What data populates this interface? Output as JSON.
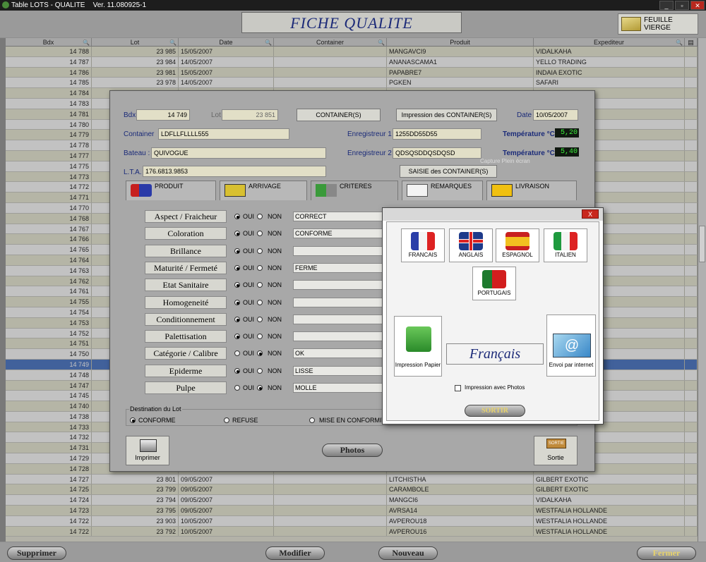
{
  "window": {
    "title": "Table LOTS - QUALITE",
    "version": "Ver. 11.080925-1"
  },
  "header": {
    "title": "FICHE QUALITE",
    "feuille_vierge": "FEUILLE VIERGE"
  },
  "grid": {
    "columns": [
      "Bdx",
      "Lot",
      "Date",
      "Container",
      "Produit",
      "Expediteur"
    ],
    "rows": [
      [
        "14 788",
        "23 985",
        "15/05/2007",
        "",
        "MANGAVCI9",
        "VIDALKAHA"
      ],
      [
        "14 787",
        "23 984",
        "14/05/2007",
        "",
        "ANANASCAMA1",
        "YELLO TRADING"
      ],
      [
        "14 786",
        "23 981",
        "15/05/2007",
        "",
        "PAPABRE7",
        "INDAIA EXOTIC"
      ],
      [
        "14 785",
        "23 978",
        "14/05/2007",
        "",
        "PGKEN",
        "SAFARI"
      ],
      [
        "14 784",
        "",
        "",
        "",
        "",
        ""
      ],
      [
        "14 783",
        "",
        "",
        "",
        "",
        ""
      ],
      [
        "14 781",
        "",
        "",
        "",
        "",
        ""
      ],
      [
        "14 780",
        "",
        "",
        "",
        "",
        ""
      ],
      [
        "14 779",
        "",
        "",
        "",
        "",
        ""
      ],
      [
        "14 778",
        "",
        "",
        "",
        "",
        ""
      ],
      [
        "14 777",
        "",
        "",
        "",
        "",
        ""
      ],
      [
        "14 775",
        "",
        "",
        "",
        "",
        ""
      ],
      [
        "14 773",
        "",
        "",
        "",
        "",
        ""
      ],
      [
        "14 772",
        "",
        "",
        "",
        "",
        "UNION"
      ],
      [
        "14 771",
        "",
        "",
        "",
        "",
        ""
      ],
      [
        "14 770",
        "",
        "",
        "",
        "",
        ""
      ],
      [
        "14 768",
        "",
        "",
        "",
        "",
        ""
      ],
      [
        "14 767",
        "",
        "",
        "",
        "",
        ""
      ],
      [
        "14 766",
        "",
        "",
        "",
        "",
        ""
      ],
      [
        "14 765",
        "",
        "",
        "",
        "",
        ""
      ],
      [
        "14 764",
        "",
        "",
        "",
        "",
        ""
      ],
      [
        "14 763",
        "",
        "",
        "",
        "",
        ""
      ],
      [
        "14 762",
        "",
        "",
        "",
        "",
        ""
      ],
      [
        "14 761",
        "",
        "",
        "",
        "",
        ""
      ],
      [
        "14 755",
        "",
        "",
        "",
        "",
        ""
      ],
      [
        "14 754",
        "",
        "",
        "",
        "",
        ""
      ],
      [
        "14 753",
        "",
        "",
        "",
        "",
        ""
      ],
      [
        "14 752",
        "",
        "",
        "",
        "",
        ""
      ],
      [
        "14 751",
        "",
        "",
        "",
        "",
        ""
      ],
      [
        "14 750",
        "",
        "",
        "",
        "",
        ""
      ],
      [
        "14 749",
        "",
        "",
        "",
        "",
        ""
      ],
      [
        "14 748",
        "",
        "",
        "",
        "",
        ""
      ],
      [
        "14 747",
        "",
        "",
        "",
        "",
        ""
      ],
      [
        "14 745",
        "",
        "",
        "",
        "",
        ""
      ],
      [
        "14 740",
        "",
        "",
        "",
        "",
        ""
      ],
      [
        "14 738",
        "",
        "",
        "",
        "",
        ""
      ],
      [
        "14 733",
        "",
        "",
        "",
        "",
        ""
      ],
      [
        "14 732",
        "",
        "",
        "",
        "",
        ""
      ],
      [
        "14 731",
        "",
        "",
        "",
        "",
        ""
      ],
      [
        "14 729",
        "",
        "",
        "",
        "",
        "NDE"
      ],
      [
        "14 728",
        "",
        "",
        "",
        "",
        ""
      ],
      [
        "14 727",
        "23 801",
        "09/05/2007",
        "",
        "LITCHISTHA",
        "GILBERT EXOTIC"
      ],
      [
        "14 725",
        "23 799",
        "09/05/2007",
        "",
        "CARAMBOLE",
        "GILBERT EXOTIC"
      ],
      [
        "14 724",
        "23 794",
        "09/05/2007",
        "",
        "MANGCI6",
        "VIDALKAHA"
      ],
      [
        "14 723",
        "23 795",
        "09/05/2007",
        "",
        "AVRSA14",
        "WESTFALIA HOLLANDE"
      ],
      [
        "14 722",
        "23 903",
        "10/05/2007",
        "",
        "AVPEROU18",
        "WESTFALIA HOLLANDE"
      ],
      [
        "14 722",
        "23 792",
        "10/05/2007",
        "",
        "AVPEROU16",
        "WESTFALIA HOLLANDE"
      ]
    ]
  },
  "footer": {
    "supprimer": "Supprimer",
    "modifier": "Modifier",
    "nouveau": "Nouveau",
    "fermer": "Fermer"
  },
  "dialog": {
    "bdx_label": "Bdx",
    "bdx": "14 749",
    "lot_label": "Lot",
    "lot": "23 851",
    "containers_btn": "CONTAINER(S)",
    "impression_btn": "Impression  des CONTAINER(S)",
    "date_label": "Date",
    "date": "10/05/2007",
    "container_label": "Container",
    "container": "LDFLLFLLLL555",
    "enreg1_label": "Enregistreur 1",
    "enreg1": "1255DD55D55",
    "temp1_label": "Température °C",
    "temp1": "5,20",
    "bateau_label": "Bateau :",
    "bateau": "QUIVOGUE",
    "enreg2_label": "Enregistreur 2",
    "enreg2": "QDSQSDDQSDQSD",
    "temp2_label": "Température °C",
    "temp2": "5,40",
    "lta_label": "L.T.A.",
    "lta": "176.6813.9853",
    "saisie_btn": "SAISIE des CONTAINER(S)",
    "ghost_text": "Capture Plein écran",
    "tabs": [
      "PRODUIT",
      "ARRIVAGE",
      "CRITERES",
      "REMARQUES",
      "LIVRAISON"
    ],
    "oui": "OUI",
    "non": "NON",
    "criteria": [
      {
        "label": "Aspect / Fraicheur",
        "value": "CORRECT",
        "oui": true
      },
      {
        "label": "Coloration",
        "value": "CONFORME",
        "oui": true
      },
      {
        "label": "Brillance",
        "value": "",
        "oui": true
      },
      {
        "label": "Maturité / Fermeté",
        "value": "FERME",
        "oui": true
      },
      {
        "label": "Etat Sanitaire",
        "value": "",
        "oui": true
      },
      {
        "label": "Homogeneité",
        "value": "",
        "oui": true
      },
      {
        "label": "Conditionnement",
        "value": "",
        "oui": true
      },
      {
        "label": "Palettisation",
        "value": "",
        "oui": true
      },
      {
        "label": "Catégorie / Calibre",
        "value": "OK",
        "oui": false
      },
      {
        "label": "Epiderme",
        "value": "LISSE",
        "oui": true
      },
      {
        "label": "Pulpe",
        "value": "MOLLE",
        "oui": false
      }
    ],
    "destination_label": "Destination du Lot",
    "dest_conforme": "CONFORME",
    "dest_refuse": "REFUSE",
    "dest_mise": "MISE EN CONFORMITE",
    "imprimer": "Imprimer",
    "photos": "Photos",
    "sortie": "Sortie",
    "sortie_sign": "SORTIE"
  },
  "lang": {
    "close": "X",
    "francais": "FRANCAIS",
    "anglais": "ANGLAIS",
    "espagnol": "ESPAGNOL",
    "italien": "ITALIEN",
    "portugais": "PORTUGAIS",
    "impression_papier": "Impression Papier",
    "current": "Français",
    "envoi": "Envoi par internet",
    "photos_chk": "Impression avec Photos",
    "sortir": "SORTIR"
  }
}
